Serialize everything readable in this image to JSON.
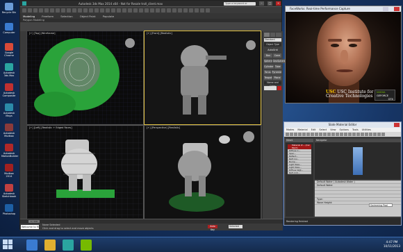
{
  "desktop": {
    "icons": [
      {
        "label": "Recycle Bin",
        "color": "#6a9bd8"
      },
      {
        "label": "Computer",
        "color": "#3a7bd0"
      },
      {
        "label": "Google Chrome",
        "color": "#d94a38"
      },
      {
        "label": "Autodesk 3ds Max",
        "color": "#2aa5a0"
      },
      {
        "label": "Autodesk Composite",
        "color": "#c03030"
      },
      {
        "label": "Autodesk Maya",
        "color": "#2b8aa8"
      },
      {
        "label": "Autodesk Mudbox",
        "color": "#8a3a3a"
      },
      {
        "label": "Autodesk MotionBuilder",
        "color": "#b02828"
      },
      {
        "label": "Mudbox 2014",
        "color": "#a02020"
      },
      {
        "label": "Autodesk Sketchbook",
        "color": "#c04040"
      },
      {
        "label": "Photoshop",
        "color": "#1d5fa5"
      }
    ]
  },
  "max": {
    "title": "Autodesk 3ds Max 2014 x64 - Not for Resale   troll_client.max",
    "search_placeholder": "Type a keyword or phrase",
    "ribbon": [
      "Modeling",
      "Freeform",
      "Selection",
      "Object Paint",
      "Populate"
    ],
    "ribbon_sub": "Polygon Modeling",
    "viewports": [
      {
        "label": "[+] [Top] [Wireframe]"
      },
      {
        "label": "[+] [Front] [Realistic]"
      },
      {
        "label": "[+] [Left] [Realistic + Edged Faces]"
      },
      {
        "label": "[+] [Perspective] [Realistic]"
      }
    ],
    "command_panel": {
      "dropdown": "Standard Primitives",
      "section_object": "Object Type",
      "autogrid": "AutoGrid",
      "buttons": [
        [
          "Box",
          "Cone"
        ],
        [
          "Sphere",
          "GeoSphere"
        ],
        [
          "Cylinder",
          "Tube"
        ],
        [
          "Torus",
          "Pyramid"
        ],
        [
          "Teapot",
          "Plane"
        ]
      ],
      "section_name": "Name and Color"
    },
    "timeline": {
      "frame": "0 / 100"
    },
    "status": {
      "welcome": "Welcome to M",
      "line1": "None Selected",
      "line2": "Click and drag to select and move objects",
      "autokey": "Auto Key",
      "selected": "Selected"
    }
  },
  "faceworks": {
    "title": "FaceWorks: Real-time Performance Capture",
    "usc_line1": "USC Institute for",
    "usc_line2": "Creative Technologies",
    "badge_brand": "NVIDIA",
    "badge_line1": "GEFORCE",
    "badge_line2": "GTX"
  },
  "slate": {
    "title": "Slate Material Editor",
    "menu": [
      "Modes",
      "Material",
      "Edit",
      "Select",
      "View",
      "Options",
      "Tools",
      "Utilities"
    ],
    "view_tab": "View1",
    "navigator": "Navigator",
    "node_title": "Material #... (Car Paint)",
    "node_rows": [
      "Diffuse C...",
      "Spec...",
      "Reflect...",
      "Refl Col...",
      "Bump...",
      "Light Pass...",
      "Light Pass...",
      "Diffuse Wgt...",
      "Refl Amt..."
    ],
    "param_rows": [
      "Default Water  ( Autodesk Water )",
      "Default Water",
      "",
      "",
      "",
      "Type:",
      "Wave Height:"
    ],
    "param_dropdown": "Swimming Pool",
    "status": "Rendering finished"
  },
  "taskbar": {
    "time": "4:47 PM",
    "date": "10/11/2013"
  }
}
